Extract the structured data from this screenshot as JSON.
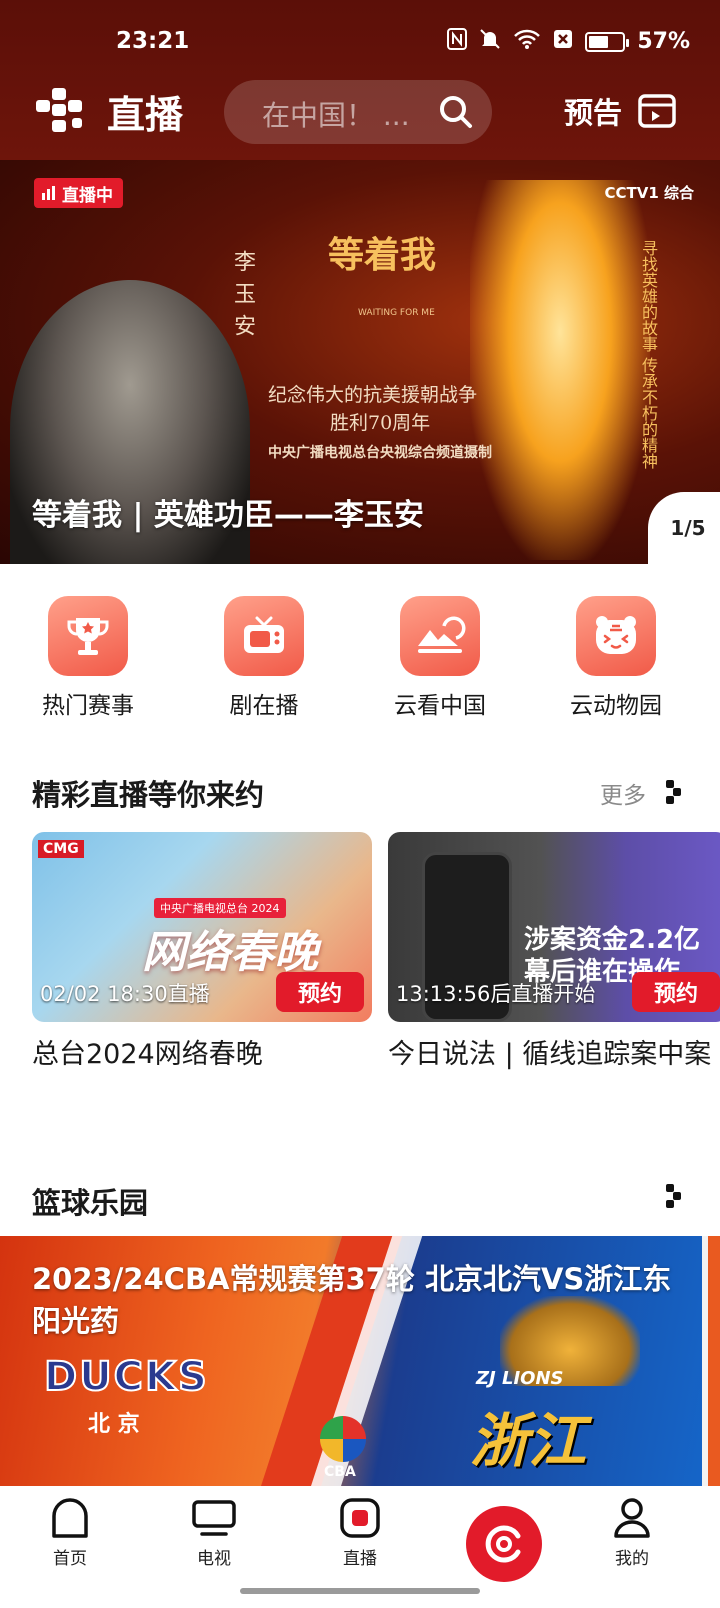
{
  "status_bar": {
    "time": "23:21",
    "battery_percent": "57%",
    "battery_level": 0.57,
    "icons": [
      "nfc-icon",
      "mute-icon",
      "wifi-icon",
      "sim-off-icon",
      "battery-icon"
    ]
  },
  "header": {
    "title": "直播",
    "search_placeholder": "在中国！ ...",
    "preview_label": "预告"
  },
  "banner": {
    "live_badge": "直播中",
    "channel_tag": "CCTV1 综合",
    "caption": "等着我 | 英雄功臣——李玉安",
    "pager": "1/5",
    "art_name": "李玉安",
    "art_show": "等着我",
    "art_show_sub": "WAITING FOR ME",
    "art_line1": "纪念伟大的抗美援朝战争",
    "art_line2": "胜利70周年",
    "art_line3": "中央广播电视总台央视综合频道摄制",
    "art_side": "寻找英雄的故事 传承不朽的精神"
  },
  "quick_entries": [
    {
      "label": "热门赛事",
      "icon": "trophy-icon"
    },
    {
      "label": "剧在播",
      "icon": "tv-icon"
    },
    {
      "label": "云看中国",
      "icon": "landscape-icon"
    },
    {
      "label": "云动物园",
      "icon": "tiger-icon"
    }
  ],
  "section_live": {
    "title": "精彩直播等你来约",
    "more": "更多"
  },
  "live_cards": [
    {
      "overlay": "02/02 18:30直播",
      "button": "预约",
      "title": "总台2024网络春晚",
      "art_brand": "CMG",
      "art_text": "网络春晚",
      "art_top": "中央广播电视总台 2024"
    },
    {
      "overlay": "13:13:56后直播开始",
      "button": "预约",
      "title": "今日说法 | 循线追踪案中案",
      "art_text": "涉案资金2.2亿 幕后谁在操作"
    }
  ],
  "section_basketball": {
    "title": "篮球乐园"
  },
  "basketball_card": {
    "title": "2023/24CBA常规赛第37轮 北京北汽VS浙江东阳光药",
    "team1": "DUCKS",
    "team1_city": "北  京",
    "team2": "浙江",
    "team2_name": "ZJ LIONS",
    "league": "CBA"
  },
  "bottom_nav": [
    {
      "label": "首页",
      "icon": "home-icon"
    },
    {
      "label": "电视",
      "icon": "tv-screen-icon"
    },
    {
      "label": "直播",
      "icon": "live-icon"
    },
    {
      "label": "",
      "icon": "ysp-logo-icon"
    },
    {
      "label": "我的",
      "icon": "profile-icon"
    }
  ]
}
